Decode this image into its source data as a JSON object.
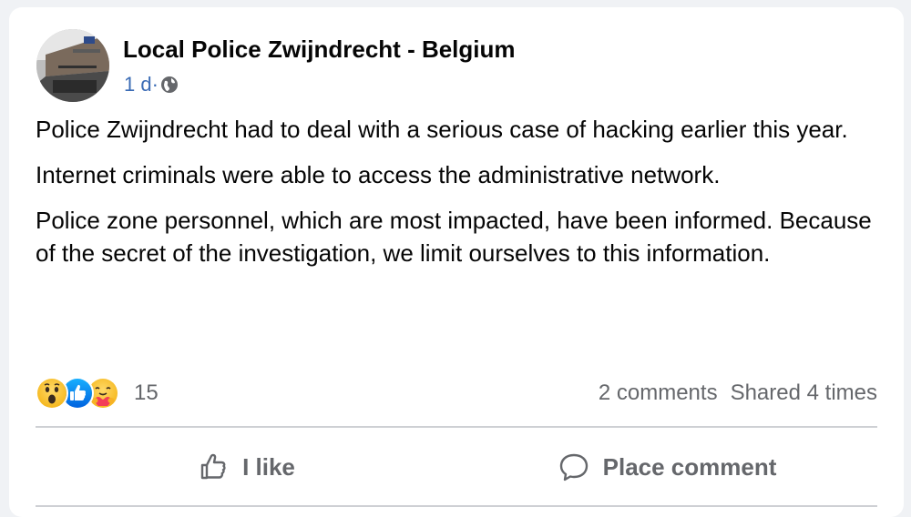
{
  "post": {
    "author": "Local Police Zwijndrecht - Belgium",
    "time": "1 d·",
    "paragraphs": [
      "Police Zwijndrecht had to deal with a serious case of hacking earlier this year.",
      "Internet criminals were able to access the administrative network.",
      "Police zone personnel, which are most impacted, have been informed. Because of the secret of the investigation, we limit ourselves to this information."
    ]
  },
  "reactions": {
    "icons": [
      "wow-emoji-icon",
      "like-thumb-icon",
      "care-emoji-icon"
    ],
    "count": "15"
  },
  "stats": {
    "comments": "2 comments",
    "shares": "Shared 4 times"
  },
  "actions": {
    "like_label": "I like",
    "comment_label": "Place comment"
  },
  "colors": {
    "background": "#f0f2f5",
    "card": "#ffffff",
    "meta_link": "#3a6bb5",
    "secondary_text": "#65676b",
    "like_blue": "#1877f2"
  }
}
